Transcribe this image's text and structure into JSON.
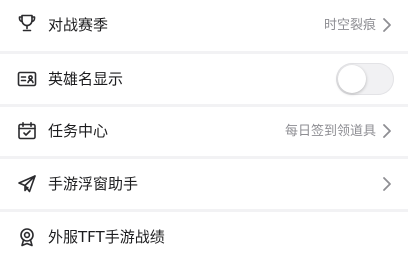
{
  "settings": {
    "items": [
      {
        "label": "对战赛季",
        "value": "时空裂痕",
        "icon": "trophy-icon",
        "accessory": "chevron"
      },
      {
        "label": "英雄名显示",
        "icon": "id-card-icon",
        "accessory": "toggle",
        "toggle_on": false
      },
      {
        "label": "任务中心",
        "value": "每日签到领道具",
        "icon": "calendar-check-icon",
        "accessory": "chevron"
      },
      {
        "label": "手游浮窗助手",
        "icon": "paper-plane-icon",
        "accessory": "chevron"
      },
      {
        "label": "外服TFT手游战绩",
        "icon": "medal-icon",
        "accessory": "none"
      }
    ]
  },
  "colors": {
    "background": "#f2f2f4",
    "row": "#ffffff",
    "text": "#1c1c1e",
    "secondary_text": "#8e8e93",
    "toggle_off_track": "#f1f1f3"
  }
}
